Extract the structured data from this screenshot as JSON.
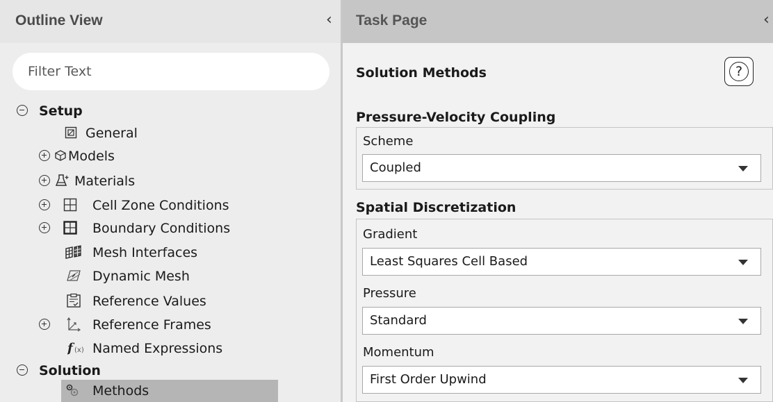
{
  "outline": {
    "title": "Outline View",
    "filter_placeholder": "Filter Text",
    "tree": [
      {
        "label": "Setup",
        "type": "section",
        "toggle": "minus"
      },
      {
        "label": "General",
        "icon": "general-icon"
      },
      {
        "label": "Models",
        "icon": "models-icon",
        "toggle": "plus"
      },
      {
        "label": "Materials",
        "icon": "materials-icon",
        "toggle": "plus"
      },
      {
        "label": "Cell Zone Conditions",
        "icon": "cell-zone-icon",
        "toggle": "plus"
      },
      {
        "label": "Boundary Conditions",
        "icon": "boundary-icon",
        "toggle": "plus"
      },
      {
        "label": "Mesh Interfaces",
        "icon": "mesh-interfaces-icon"
      },
      {
        "label": "Dynamic Mesh",
        "icon": "dynamic-mesh-icon"
      },
      {
        "label": "Reference Values",
        "icon": "reference-values-icon"
      },
      {
        "label": "Reference Frames",
        "icon": "reference-frames-icon",
        "toggle": "plus"
      },
      {
        "label": "Named Expressions",
        "icon": "named-expressions-icon"
      },
      {
        "label": "Solution",
        "type": "section",
        "toggle": "minus"
      },
      {
        "label": "Methods",
        "icon": "methods-icon",
        "selected": true
      }
    ]
  },
  "task": {
    "title": "Task Page",
    "heading": "Solution Methods",
    "help_symbol": "?",
    "pv_coupling": {
      "title": "Pressure-Velocity Coupling",
      "scheme_label": "Scheme",
      "scheme_value": "Coupled"
    },
    "spatial": {
      "title": "Spatial Discretization",
      "gradient_label": "Gradient",
      "gradient_value": "Least Squares Cell Based",
      "pressure_label": "Pressure",
      "pressure_value": "Standard",
      "momentum_label": "Momentum",
      "momentum_value": "First Order Upwind"
    }
  }
}
